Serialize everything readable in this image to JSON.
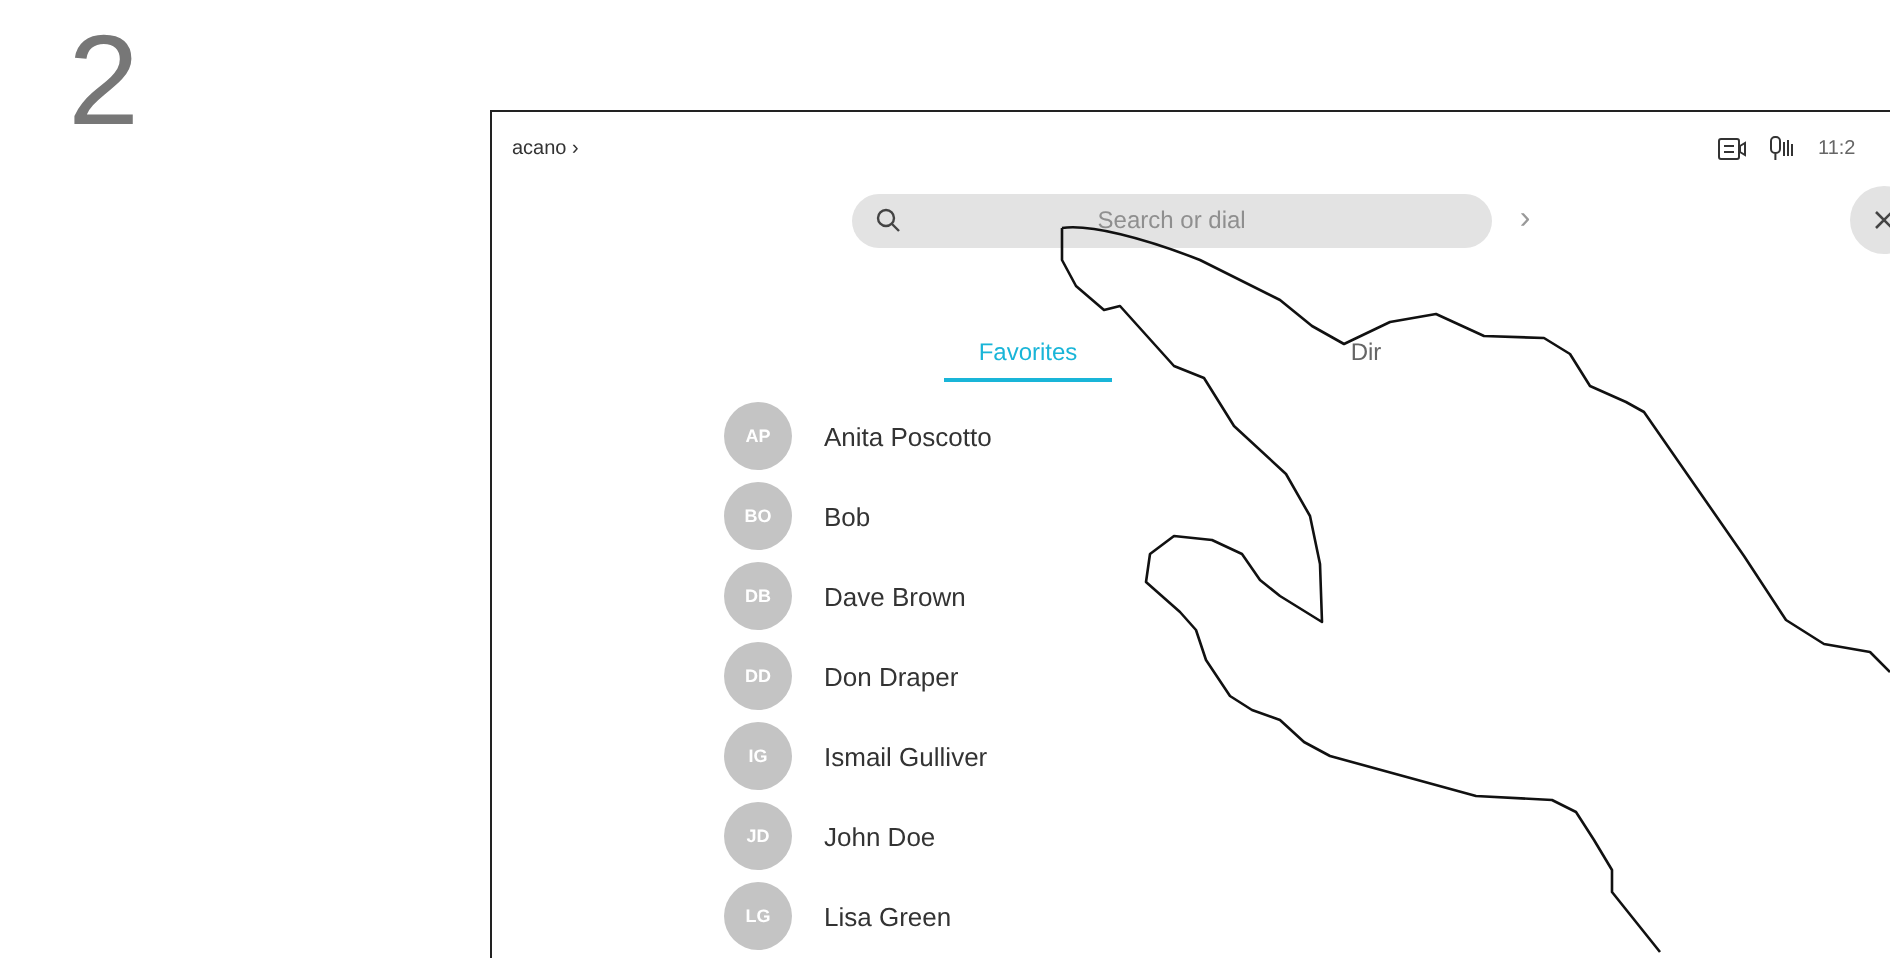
{
  "step": "2",
  "top_bar": {
    "device": "acano",
    "chevron": "›",
    "time": "11:2"
  },
  "search": {
    "placeholder": "Search or dial",
    "go": "›"
  },
  "tabs": [
    {
      "label": "Favorites",
      "selected": true
    },
    {
      "label": "Dir",
      "selected": false
    }
  ],
  "contacts": [
    {
      "initials": "AP",
      "name": "Anita Poscotto"
    },
    {
      "initials": "BO",
      "name": "Bob"
    },
    {
      "initials": "DB",
      "name": "Dave Brown"
    },
    {
      "initials": "DD",
      "name": "Don Draper"
    },
    {
      "initials": "IG",
      "name": "Ismail Gulliver"
    },
    {
      "initials": "JD",
      "name": "John Doe"
    },
    {
      "initials": "LG",
      "name": "Lisa Green"
    }
  ]
}
